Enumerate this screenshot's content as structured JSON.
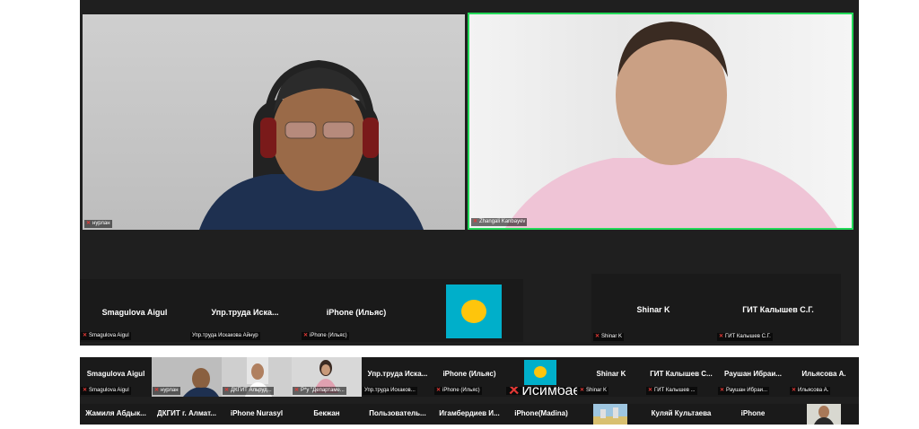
{
  "main_videos": [
    {
      "name": "нурлан"
    },
    {
      "name": "Zhangali Kanbayev"
    }
  ],
  "mid_strip_a": [
    {
      "title": "Smagulova Aigul",
      "label": "Smagulova Aigul"
    },
    {
      "title": "Упр.труда  Иска...",
      "label": "Упр.труда Искакова Айнур"
    },
    {
      "title": "iPhone (Ильяс)",
      "label": "iPhone (Ильяс)"
    }
  ],
  "mid_strip_b": [
    {
      "title": "Shinar K",
      "label": "Shinar K"
    },
    {
      "title": "ГИТ Калышев С.Г.",
      "label": "ГИТ Калышев С.Г."
    }
  ],
  "bottom_row1": [
    {
      "title": "Smagulova Aigul",
      "label": "Smagulova Aigul"
    },
    {
      "title": "",
      "label": "нурлан"
    },
    {
      "title": "",
      "label": "ДКГИТ Альруд..."
    },
    {
      "title": "",
      "label": "Р*у \"Департаме..."
    },
    {
      "title": "Упр.труда  Иска...",
      "label": "Упр.труда Искаков..."
    },
    {
      "title": "iPhone (Ильяс)",
      "label": "iPhone (Ильяс)"
    },
    {
      "title": "",
      "label": "Исимбаева Ж.Б..."
    },
    {
      "title": "Shinar K",
      "label": "Shinar K"
    },
    {
      "title": "ГИТ Калышев С...",
      "label": "ГИТ Калышев ..."
    },
    {
      "title": "Раушан  Ибраи...",
      "label": "Раушан Ибраи..."
    },
    {
      "title": "Ильясова А.",
      "label": "Ильясова А."
    }
  ],
  "bottom_row2": [
    {
      "title": "Жамиля  Абдык..."
    },
    {
      "title": "ДКГИТ г. Алмат..."
    },
    {
      "title": "iPhone Nurasyl"
    },
    {
      "title": "Бекжан"
    },
    {
      "title": "Пользователь..."
    },
    {
      "title": "Игамбердиев  И..."
    },
    {
      "title": "iPhone(Madina)"
    },
    {
      "title": ""
    },
    {
      "title": "Куляй Культаева"
    },
    {
      "title": "iPhone"
    },
    {
      "title": ""
    }
  ],
  "colors": {
    "active_speaker": "#23d959",
    "muted_icon": "#e53935",
    "flag": "#00afca",
    "sun": "#fec50c"
  }
}
